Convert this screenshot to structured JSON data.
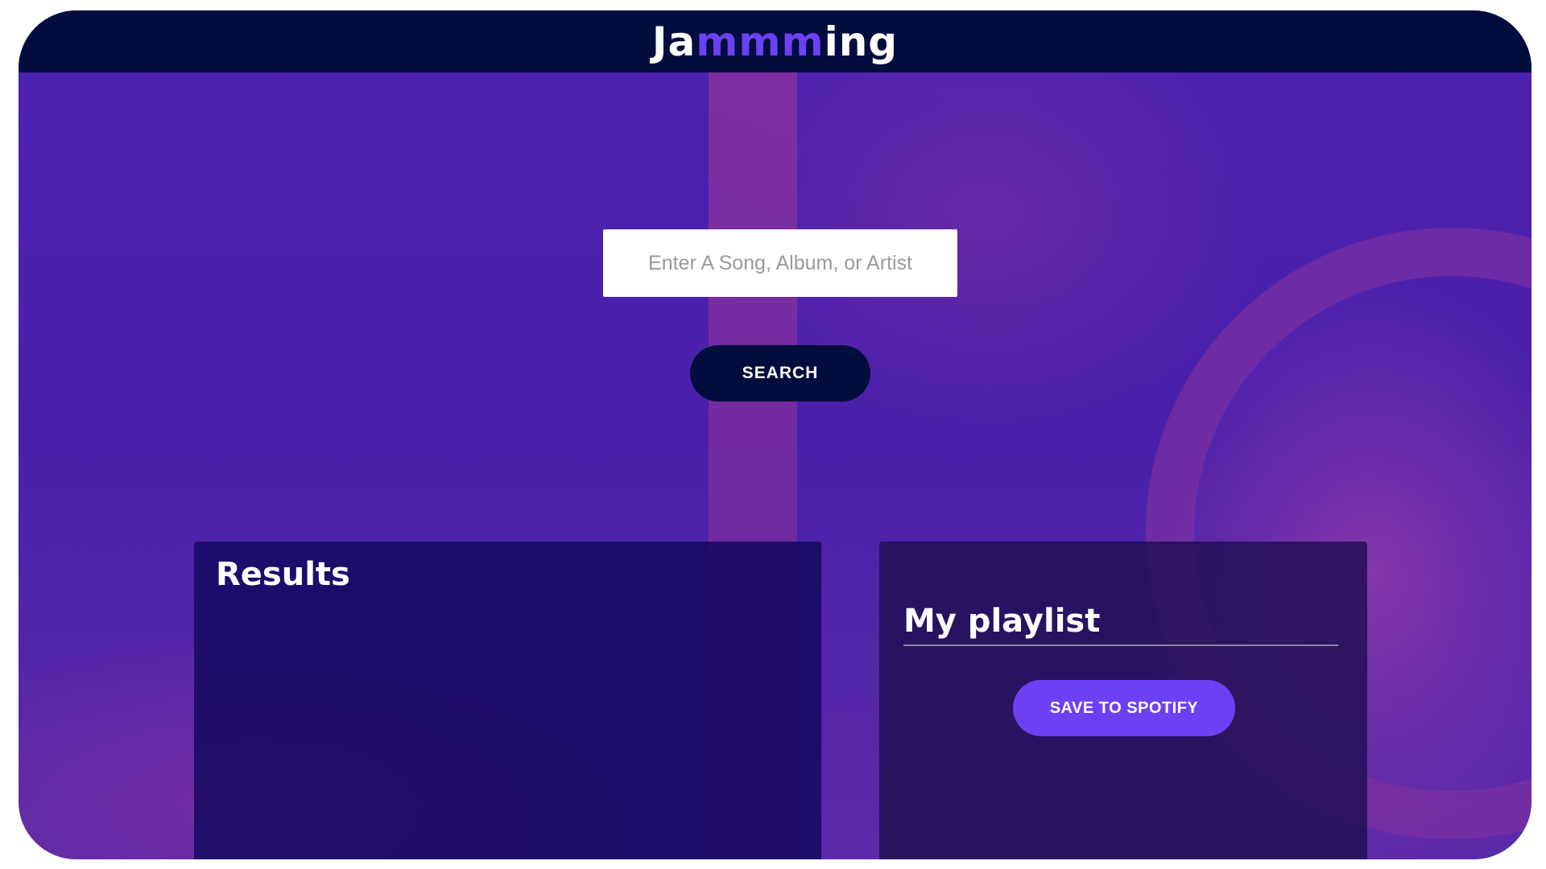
{
  "app": {
    "logo_start": "Ja",
    "logo_accent": "mmm",
    "logo_end": "ing"
  },
  "search": {
    "placeholder": "Enter A Song, Album, or Artist",
    "value": "",
    "button_label": "SEARCH"
  },
  "results": {
    "title": "Results",
    "tracks": []
  },
  "playlist": {
    "name": "My playlist",
    "tracks": [],
    "save_label": "SAVE TO SPOTIFY"
  },
  "colors": {
    "header_bg": "#020d3e",
    "accent": "#6c41f3",
    "background": "#4a1fa8",
    "panel": "#14085f"
  }
}
